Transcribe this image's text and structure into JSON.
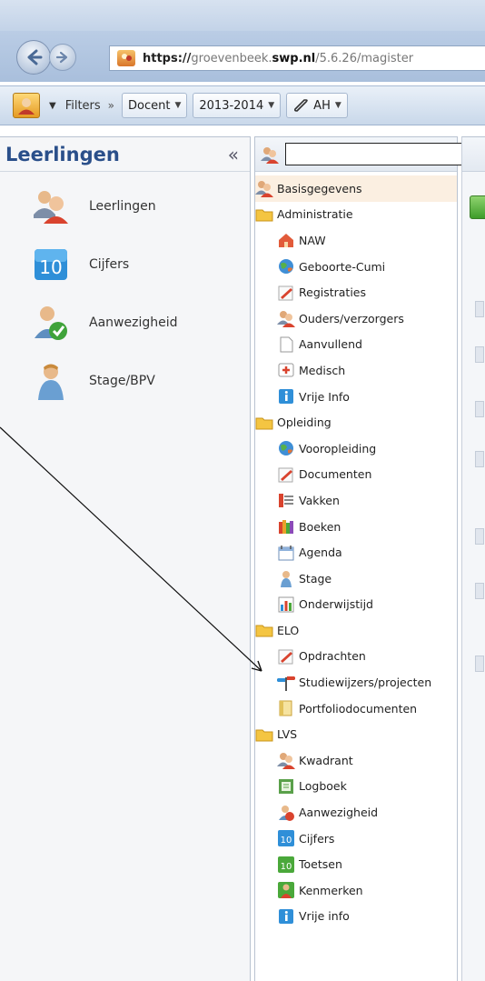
{
  "browser": {
    "url_scheme": "https://",
    "url_host_pre": "groevenbeek.",
    "url_host_dom": "swp.nl",
    "url_path": "/5.6.26/magister"
  },
  "toolbar": {
    "filters_label": "Filters",
    "filters_sep": "»",
    "role_value": "Docent",
    "year_value": "2013-2014",
    "user_value": "AH"
  },
  "left_panel": {
    "title": "Leerlingen",
    "collapse_glyph": "«",
    "items": [
      {
        "label": "Leerlingen",
        "icon": "students-icon"
      },
      {
        "label": "Cijfers",
        "icon": "grades-10-icon"
      },
      {
        "label": "Aanwezigheid",
        "icon": "attendance-check-icon"
      },
      {
        "label": "Stage/BPV",
        "icon": "internship-person-icon"
      }
    ]
  },
  "tree": {
    "search_value": "",
    "rows": [
      {
        "label": "Basisgegevens",
        "level": "top",
        "icon": "people",
        "selected": true
      },
      {
        "label": "Administratie",
        "level": "top",
        "icon": "folder"
      },
      {
        "label": "NAW",
        "level": "child",
        "icon": "house"
      },
      {
        "label": "Geboorte-Cumi",
        "level": "child",
        "icon": "globe"
      },
      {
        "label": "Registraties",
        "level": "child",
        "icon": "pencil"
      },
      {
        "label": "Ouders/verzorgers",
        "level": "child",
        "icon": "people"
      },
      {
        "label": "Aanvullend",
        "level": "child",
        "icon": "page"
      },
      {
        "label": "Medisch",
        "level": "child",
        "icon": "medical"
      },
      {
        "label": "Vrije Info",
        "level": "child",
        "icon": "info"
      },
      {
        "label": "Opleiding",
        "level": "top",
        "icon": "folder"
      },
      {
        "label": "Vooropleiding",
        "level": "child",
        "icon": "globe"
      },
      {
        "label": "Documenten",
        "level": "child",
        "icon": "pencil"
      },
      {
        "label": "Vakken",
        "level": "child",
        "icon": "books-list"
      },
      {
        "label": "Boeken",
        "level": "child",
        "icon": "books"
      },
      {
        "label": "Agenda",
        "level": "child",
        "icon": "calendar"
      },
      {
        "label": "Stage",
        "level": "child",
        "icon": "person"
      },
      {
        "label": "Onderwijstijd",
        "level": "child",
        "icon": "bars"
      },
      {
        "label": "ELO",
        "level": "top",
        "icon": "folder"
      },
      {
        "label": "Opdrachten",
        "level": "child",
        "icon": "pencil"
      },
      {
        "label": "Studiewijzers/projecten",
        "level": "child",
        "icon": "signpost"
      },
      {
        "label": "Portfoliodocumenten",
        "level": "child",
        "icon": "portfolio"
      },
      {
        "label": "LVS",
        "level": "top",
        "icon": "folder"
      },
      {
        "label": "Kwadrant",
        "level": "child",
        "icon": "people"
      },
      {
        "label": "Logboek",
        "level": "child",
        "icon": "logbook"
      },
      {
        "label": "Aanwezigheid",
        "level": "child",
        "icon": "attendance"
      },
      {
        "label": "Cijfers",
        "level": "child",
        "icon": "grade10"
      },
      {
        "label": "Toetsen",
        "level": "child",
        "icon": "test10"
      },
      {
        "label": "Kenmerken",
        "level": "child",
        "icon": "features"
      },
      {
        "label": "Vrije info",
        "level": "child",
        "icon": "info"
      }
    ]
  },
  "colors": {
    "title_blue": "#2a4f8a",
    "folder_yellow": "#f4c542",
    "selected_row": "#fbefe1"
  }
}
